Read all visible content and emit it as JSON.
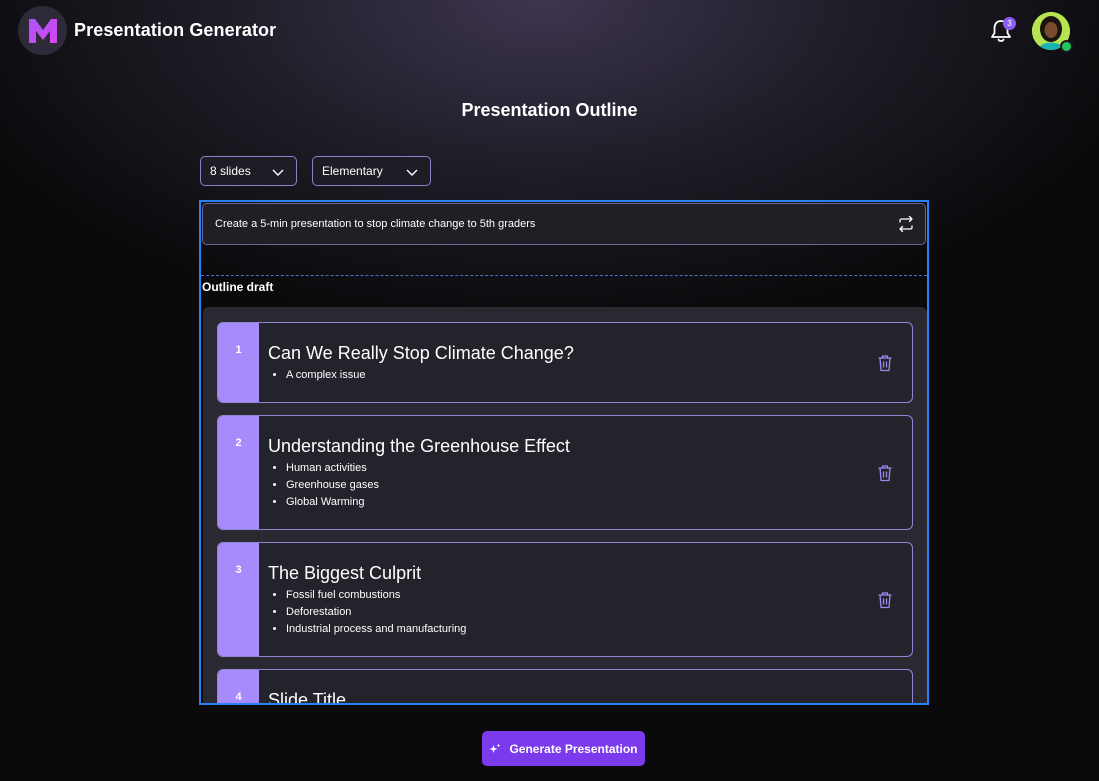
{
  "app": {
    "title": "Presentation Generator",
    "notification_count": "3"
  },
  "page": {
    "title": "Presentation Outline"
  },
  "controls": {
    "slides": "8 slides",
    "level": "Elementary"
  },
  "prompt": {
    "text": "Create a 5-min presentation to stop climate change to 5th graders"
  },
  "outline": {
    "label": "Outline draft",
    "slides": [
      {
        "number": "1",
        "title": "Can We Really Stop Climate Change?",
        "bullets": [
          "A complex issue"
        ]
      },
      {
        "number": "2",
        "title": "Understanding the Greenhouse Effect",
        "bullets": [
          "Human activities",
          "Greenhouse gases",
          "Global Warming"
        ]
      },
      {
        "number": "3",
        "title": "The Biggest Culprit",
        "bullets": [
          "Fossil fuel combustions",
          "Deforestation",
          "Industrial process and manufacturing"
        ]
      },
      {
        "number": "4",
        "title": "Slide Title",
        "bullets": []
      }
    ]
  },
  "actions": {
    "generate": "Generate Presentation"
  },
  "colors": {
    "accent": "#7c3aed",
    "slide_number_bg": "#a78bfa",
    "selection": "#2a82f0"
  }
}
